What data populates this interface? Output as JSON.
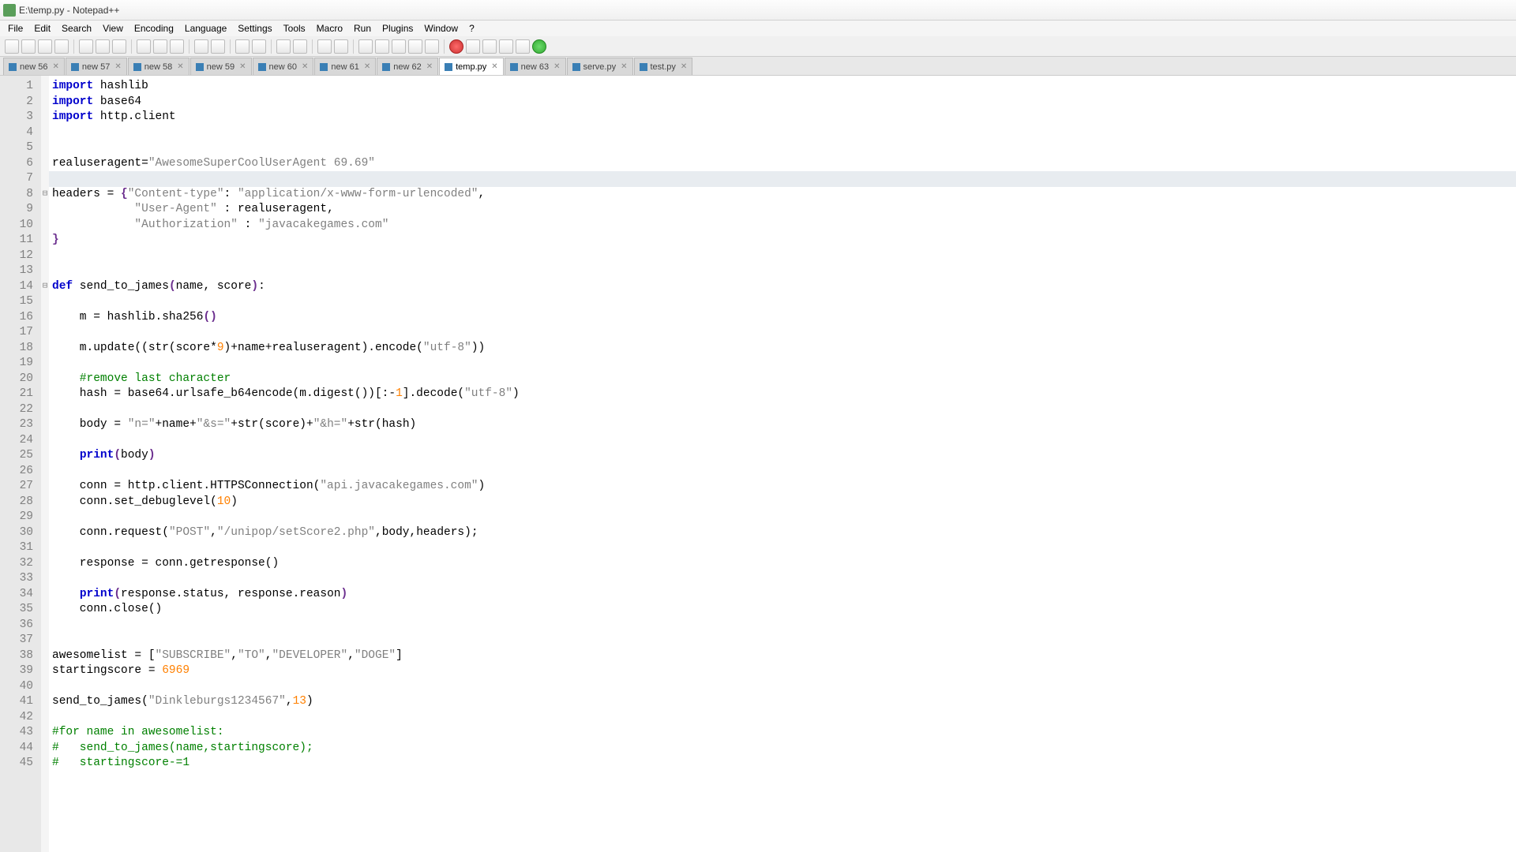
{
  "window": {
    "title": "E:\\temp.py - Notepad++"
  },
  "menu": [
    "File",
    "Edit",
    "Search",
    "View",
    "Encoding",
    "Language",
    "Settings",
    "Tools",
    "Macro",
    "Run",
    "Plugins",
    "Window",
    "?"
  ],
  "tabs": [
    {
      "label": "new 56",
      "active": false
    },
    {
      "label": "new 57",
      "active": false
    },
    {
      "label": "new 58",
      "active": false
    },
    {
      "label": "new 59",
      "active": false
    },
    {
      "label": "new 60",
      "active": false
    },
    {
      "label": "new 61",
      "active": false
    },
    {
      "label": "new 62",
      "active": false
    },
    {
      "label": "temp.py",
      "active": true
    },
    {
      "label": "new 63",
      "active": false
    },
    {
      "label": "serve.py",
      "active": false
    },
    {
      "label": "test.py",
      "active": false
    }
  ],
  "current_line": 7,
  "lines": 45,
  "code": {
    "l1": {
      "kw": "import",
      "rest": " hashlib"
    },
    "l2": {
      "kw": "import",
      "rest": " base64"
    },
    "l3": {
      "kw": "import",
      "rest": " http.client"
    },
    "l6": {
      "a": "realuseragent=",
      "s": "\"AwesomeSuperCoolUserAgent 69.69\""
    },
    "l8": {
      "a": "headers = ",
      "b": "{",
      "s1": "\"Content-type\"",
      "c": ": ",
      "s2": "\"application/x-www-form-urlencoded\"",
      "d": ","
    },
    "l9": {
      "pad": "            ",
      "s1": "\"User-Agent\"",
      "a": " : realuseragent,"
    },
    "l10": {
      "pad": "            ",
      "s1": "\"Authorization\"",
      "a": " : ",
      "s2": "\"javacakegames.com\""
    },
    "l11": "}",
    "l14": {
      "kw": "def",
      "fn": " send_to_james",
      "p": "(name, score):"
    },
    "l16": "    m = hashlib.sha256()",
    "l18": {
      "a": "    m.update((str(score*",
      "n": "9",
      "b": ")+name+realuseragent).encode(",
      "s": "\"utf-8\"",
      "c": "))"
    },
    "l20": "    #remove last character",
    "l21": {
      "a": "    hash = base64.urlsafe_b64encode(m.digest())[:-",
      "n": "1",
      "b": "].decode(",
      "s": "\"utf-8\"",
      "c": ")"
    },
    "l23": {
      "a": "    body = ",
      "s1": "\"n=\"",
      "b": "+name+",
      "s2": "\"&s=\"",
      "c": "+str(score)+",
      "s3": "\"&h=\"",
      "d": "+str(hash)"
    },
    "l25": "    print(body)",
    "l27": {
      "a": "    conn = http.client.HTTPSConnection(",
      "s": "\"api.javacakegames.com\"",
      "b": ")"
    },
    "l28": {
      "a": "    conn.set_debuglevel(",
      "n": "10",
      "b": ")"
    },
    "l30": {
      "a": "    conn.request(",
      "s1": "\"POST\"",
      "b": ",",
      "s2": "\"/unipop/setScore2.php\"",
      "c": ",body,headers);"
    },
    "l32": "    response = conn.getresponse()",
    "l34": "    print(response.status, response.reason)",
    "l35": "    conn.close()",
    "l38": {
      "a": "awesomelist = [",
      "s1": "\"SUBSCRIBE\"",
      "b": ",",
      "s2": "\"TO\"",
      "c": ",",
      "s3": "\"DEVELOPER\"",
      "d": ",",
      "s4": "\"DOGE\"",
      "e": "]"
    },
    "l39": {
      "a": "startingscore = ",
      "n": "6969"
    },
    "l41": {
      "a": "send_to_james(",
      "s": "\"Dinkleburgs1234567\"",
      "b": ",",
      "n": "13",
      "c": ")"
    },
    "l43": "#for name in awesomelist:",
    "l44": "#   send_to_james(name,startingscore);",
    "l45": "#   startingscore-=1"
  }
}
